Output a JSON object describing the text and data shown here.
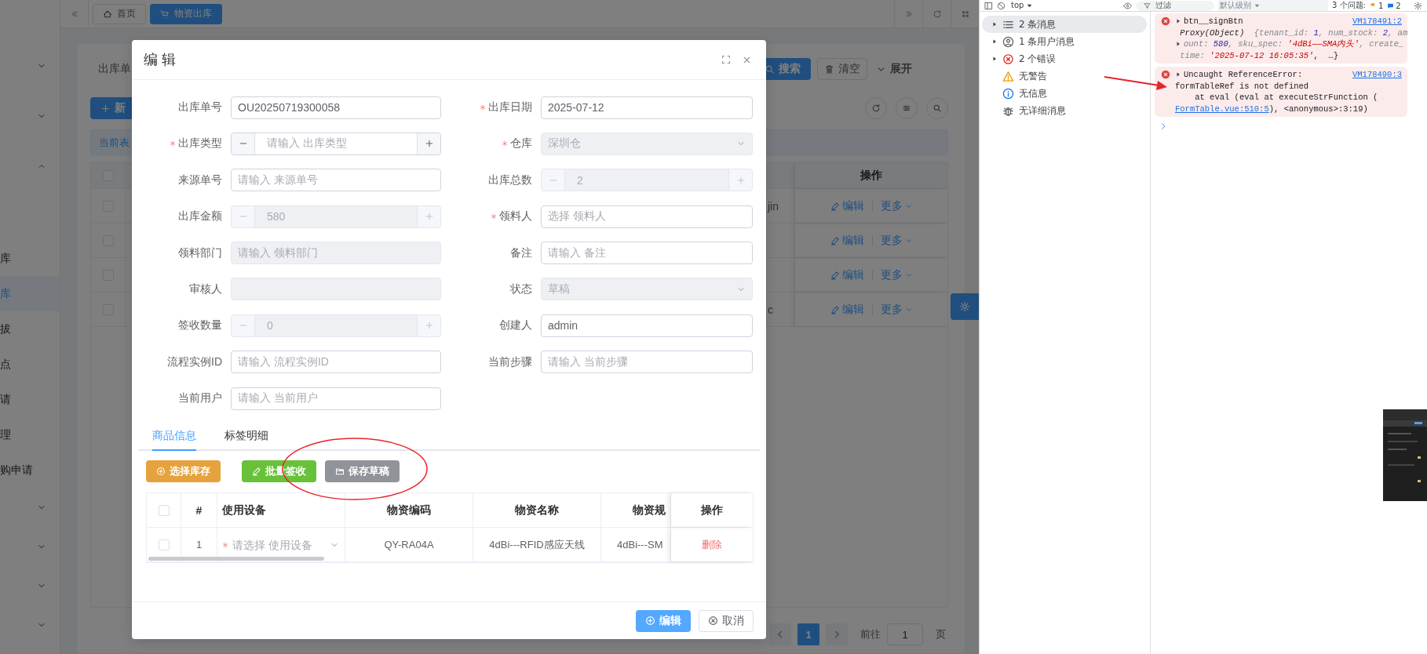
{
  "sidebar": {
    "groups": [
      {
        "expanded": false
      },
      {
        "expanded": false
      },
      {
        "expanded": true,
        "children": [
          {
            "label": "库",
            "selected": false
          },
          {
            "label": "库",
            "selected": true
          },
          {
            "label": "拔",
            "selected": false
          },
          {
            "label": "点",
            "selected": false
          },
          {
            "label": "请",
            "selected": false
          },
          {
            "label": "理",
            "selected": false
          },
          {
            "label": "购申请",
            "selected": false
          }
        ]
      },
      {
        "expanded": false
      },
      {
        "expanded": false
      },
      {
        "expanded": false
      },
      {
        "expanded": false
      }
    ]
  },
  "tabs": [
    {
      "label": "首页",
      "selected": false,
      "kind": "home"
    },
    {
      "label": "物资出库",
      "selected": true,
      "kind": "cart"
    }
  ],
  "search": {
    "label": "出库单",
    "buttons": [
      {
        "label": "搜索",
        "kind": "primary"
      },
      {
        "label": "清空",
        "kind": "clear"
      },
      {
        "label": "展开",
        "kind": "expand"
      }
    ]
  },
  "toolbar": {
    "add_label": "新"
  },
  "alert": "当前表",
  "table": {
    "header_checked": false,
    "action_header": "操作",
    "rows": [
      {
        "checked": false,
        "text": "jin",
        "edit": "编辑",
        "more": "更多"
      },
      {
        "checked": false,
        "edit": "编辑",
        "more": "更多"
      },
      {
        "checked": false,
        "edit": "编辑",
        "more": "更多"
      },
      {
        "checked": false,
        "text": "c",
        "edit": "编辑",
        "more": "更多"
      }
    ]
  },
  "pagination": {
    "pages": [
      {
        "label": "1",
        "selected": true
      }
    ],
    "goto": "前往",
    "page_input": "1",
    "suffix": "页"
  },
  "modal": {
    "title": "编 辑",
    "fields": [
      {
        "label": "出库单号",
        "required": false,
        "kind": "text",
        "value": "OU20250719300058",
        "disabled": false
      },
      {
        "label": "出库日期",
        "required": true,
        "kind": "text",
        "value": "2025-07-12",
        "disabled": false
      },
      {
        "label": "出库类型",
        "required": true,
        "kind": "number",
        "placeholder": "请输入 出库类型",
        "disabled": false
      },
      {
        "label": "仓库",
        "required": true,
        "kind": "select",
        "value": "深圳仓",
        "disabled": true
      },
      {
        "label": "来源单号",
        "required": false,
        "kind": "text",
        "placeholder": "请输入 来源单号",
        "disabled": false
      },
      {
        "label": "出库总数",
        "required": false,
        "kind": "number",
        "value": "2",
        "disabled": true
      },
      {
        "label": "出库金额",
        "required": false,
        "kind": "number",
        "value": "580",
        "disabled": true
      },
      {
        "label": "领料人",
        "required": true,
        "kind": "text",
        "placeholder": "选择 领料人",
        "disabled": false
      },
      {
        "label": "领料部门",
        "required": false,
        "kind": "text",
        "placeholder": "请输入 领料部门",
        "disabled": true
      },
      {
        "label": "备注",
        "required": false,
        "kind": "text",
        "placeholder": "请输入 备注",
        "disabled": false
      },
      {
        "label": "审核人",
        "required": false,
        "kind": "text",
        "disabled": true
      },
      {
        "label": "状态",
        "required": false,
        "kind": "select",
        "value": "草稿",
        "disabled": true
      },
      {
        "label": "签收数量",
        "required": false,
        "kind": "number",
        "value": "0",
        "disabled": true
      },
      {
        "label": "创建人",
        "required": false,
        "kind": "text",
        "value": "admin",
        "disabled": false
      },
      {
        "label": "流程实例ID",
        "required": false,
        "kind": "text",
        "placeholder": "请输入 流程实例ID",
        "disabled": false
      },
      {
        "label": "当前步骤",
        "required": false,
        "kind": "text",
        "placeholder": "请输入 当前步骤",
        "disabled": false
      },
      {
        "label": "当前用户",
        "required": false,
        "kind": "text",
        "placeholder": "请输入 当前用户",
        "disabled": false
      }
    ],
    "tabs": [
      {
        "label": "商品信息",
        "selected": true
      },
      {
        "label": "标签明细",
        "selected": false
      }
    ],
    "actions": [
      {
        "label": "选择库存",
        "kind": "select"
      },
      {
        "label": "批量签收",
        "kind": "sign"
      },
      {
        "label": "保存草稿",
        "kind": "draft"
      }
    ],
    "items_table": {
      "header_checked": false,
      "columns": [
        "#",
        "使用设备",
        "物资编码",
        "物资名称",
        "物资规",
        "操作"
      ],
      "rows": [
        {
          "checked": false,
          "index": "1",
          "device_placeholder": "请选择 使用设备",
          "device_required": true,
          "code": "QY-RA04A",
          "name": "4dBi---RFID感应天线",
          "spec": "4dBi---SM",
          "action": "删除"
        }
      ]
    },
    "footer": [
      {
        "label": "编辑",
        "kind": "primary"
      },
      {
        "label": "取消",
        "kind": "default"
      }
    ]
  },
  "devtools": {
    "toolbar": {
      "context": "top",
      "filter": "过滤",
      "level": "默认级别",
      "issues": "3 个问题:",
      "counts": [
        {
          "kind": "warning",
          "count": "1"
        },
        {
          "kind": "info",
          "count": "2"
        }
      ]
    },
    "sidebar": [
      {
        "kind": "messages",
        "label": "2 条消息",
        "expandable": true,
        "selected": true
      },
      {
        "kind": "user",
        "label": "1 条用户消息",
        "expandable": true,
        "selected": false
      },
      {
        "kind": "error",
        "label": "2 个错误",
        "expandable": true,
        "selected": false
      },
      {
        "kind": "warning",
        "label": "无警告",
        "expandable": false,
        "selected": false
      },
      {
        "kind": "info",
        "label": "无信息",
        "expandable": false,
        "selected": false
      },
      {
        "kind": "verbose",
        "label": "无详细消息",
        "expandable": false,
        "selected": false
      }
    ],
    "messages": [
      {
        "source": "VM178491:2",
        "lines": [
          [
            {
              "kind": "toggle"
            },
            {
              "kind": "name",
              "text": "btn__signBtn"
            }
          ],
          [
            {
              "kind": "type",
              "text": " Proxy(Object)"
            },
            {
              "kind": "key",
              "text": "  {tenant_id: "
            },
            {
              "kind": "num",
              "text": "1"
            },
            {
              "kind": "key",
              "text": ", num_stock: "
            },
            {
              "kind": "num",
              "text": "2"
            },
            {
              "kind": "key",
              "text": ", am"
            }
          ],
          [
            {
              "kind": "toggle"
            },
            {
              "kind": "key",
              "text": "ount: "
            },
            {
              "kind": "num",
              "text": "580"
            },
            {
              "kind": "key",
              "text": ", sku_spec: "
            },
            {
              "kind": "str",
              "text": "'4dBi——SMA内头'"
            },
            {
              "kind": "key",
              "text": ", create_"
            }
          ],
          [
            {
              "kind": "key",
              "text": " time: "
            },
            {
              "kind": "str",
              "text": "'2025-07-12 16:05:35'"
            },
            {
              "kind": "name",
              "text": ",  …}"
            }
          ]
        ]
      },
      {
        "source": "VM178490:3",
        "lines": [
          [
            {
              "kind": "toggle"
            },
            {
              "kind": "name",
              "text": "Uncaught ReferenceError:"
            }
          ],
          [
            {
              "kind": "name",
              "text": "formTableRef is not defined"
            }
          ],
          [
            {
              "kind": "name",
              "text": "    at eval (eval at executeStrFunction ("
            }
          ],
          [
            {
              "kind": "link",
              "text": "FormTable.vue:510:5"
            },
            {
              "kind": "name",
              "text": "), <anonymous>:3:19)"
            }
          ]
        ]
      }
    ]
  }
}
